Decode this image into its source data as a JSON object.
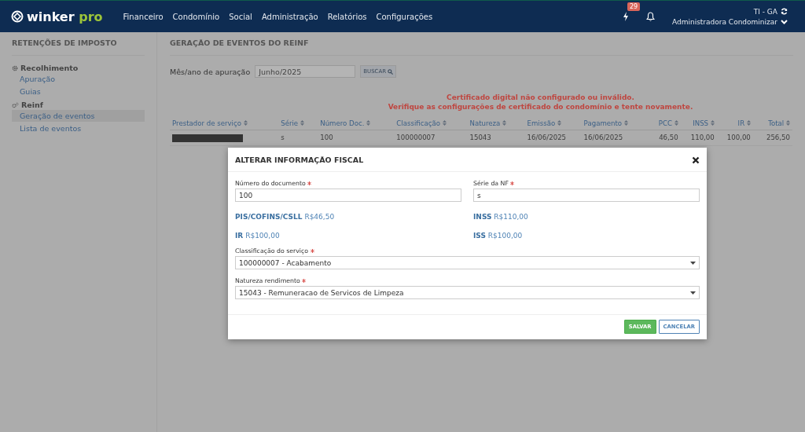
{
  "header": {
    "logo": {
      "word": "winker",
      "accent": "pro"
    },
    "nav": [
      "Financeiro",
      "Condomínio",
      "Social",
      "Administração",
      "Relatórios",
      "Configurações"
    ],
    "badge": "29",
    "account": {
      "code": "TI - GA",
      "name": "Administradora Condominizar"
    }
  },
  "sidebar": {
    "title": "RETENÇÕES DE IMPOSTO",
    "sections": [
      {
        "label": "Recolhimento",
        "kind": "gear",
        "items": [
          {
            "label": "Apuração",
            "selected": false
          },
          {
            "label": "Guias",
            "selected": false
          }
        ]
      },
      {
        "label": "Reinf",
        "kind": "gears",
        "items": [
          {
            "label": "Geração de eventos",
            "selected": true
          },
          {
            "label": "Lista de eventos",
            "selected": false
          }
        ]
      }
    ]
  },
  "main": {
    "title": "GERAÇÃO DE EVENTOS DO REINF",
    "filter": {
      "label": "Mês/ano de apuração",
      "value": "Junho/2025",
      "button": "BUSCAR"
    },
    "errors": [
      "Certificado digital não configurado ou inválido.",
      "Verifique as configurações de certificado do condomínio e tente novamente."
    ],
    "table": {
      "columns": [
        "Prestador de serviço",
        "Série",
        "Número Doc.",
        "Classificação",
        "Natureza",
        "Emissão",
        "Pagamento",
        "PCC",
        "INSS",
        "IR",
        "Total"
      ],
      "rows": [
        {
          "cells": [
            "",
            "s",
            "100",
            "100000007",
            "15043",
            "16/06/2025",
            "16/06/2025",
            "46,50",
            "110,00",
            "100,00",
            "256,50"
          ]
        }
      ]
    }
  },
  "modal": {
    "title": "ALTERAR INFORMAÇÃO FISCAL",
    "fields": [
      {
        "label": "Número do documento",
        "required": true,
        "value": "100"
      },
      {
        "label": "Série da NF",
        "required": true,
        "value": "s"
      }
    ],
    "amounts": [
      {
        "label": "PIS/COFINS/CSLL",
        "value": "R$46,50"
      },
      {
        "label": "INSS",
        "value": "R$110,00"
      },
      {
        "label": "IR",
        "value": "R$100,00"
      },
      {
        "label": "ISS",
        "value": "R$100,00"
      }
    ],
    "selects": [
      {
        "label": "Classificação do serviço",
        "required": true,
        "value": "100000007 - Acabamento"
      },
      {
        "label": "Natureza rendimento",
        "required": true,
        "value": "15043 - Remuneracao de Servicos de Limpeza"
      }
    ],
    "buttons": [
      {
        "label": "SALVAR",
        "kind": "primary"
      },
      {
        "label": "CANCELAR",
        "kind": "secondary"
      }
    ]
  }
}
